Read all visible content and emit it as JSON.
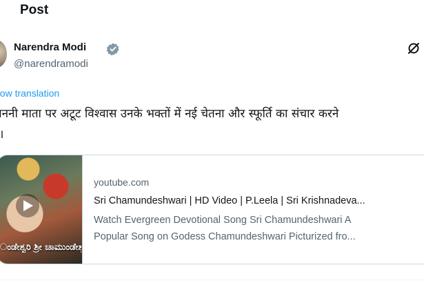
{
  "header": {
    "title": "Post"
  },
  "author": {
    "name": "Narendra Modi",
    "handle": "@narendramodi",
    "verified": true
  },
  "icons": {
    "verified": "verified-badge-icon",
    "grok": "grok-icon",
    "play": "play-icon"
  },
  "post": {
    "show_translation": "how translation",
    "text": "जननी माता पर अटूट विश्वास उनके भक्तों में नई चेतना और स्फूर्ति का संचार करने\nहै।"
  },
  "link_card": {
    "domain": "youtube.com",
    "title": "Sri Chamundeshwari | HD Video | P.Leela | Sri Krishnadeva...",
    "description_line1": "Watch Evergreen Devotional Song Sri Chamundeshwari A",
    "description_line2": "Popular Song on Godess Chamundeshwari Picturized fro...",
    "thumbnail_caption": "ಂಡೇಶ್ವರಿ ಶ್ರೀ ಚಾಮುಂಡೇಶ್ವ"
  },
  "colors": {
    "text_primary": "#0f1419",
    "text_secondary": "#536471",
    "link": "#1d9bf0",
    "verified": "#829aab",
    "border": "#cfd9de"
  }
}
